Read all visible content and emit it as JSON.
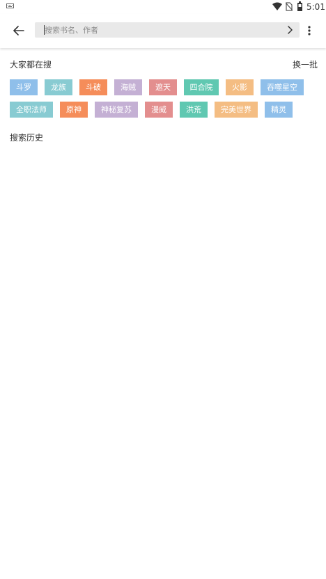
{
  "status_bar": {
    "time": "5:01",
    "icons": [
      "keyboard-icon",
      "wifi-icon",
      "no-sim-icon",
      "battery-icon"
    ]
  },
  "toolbar": {
    "back_icon": "arrow-left-icon",
    "search_placeholder": "搜索书名、作者",
    "search_value": "",
    "search_go_icon": "chevron-right-icon",
    "more_icon": "more-vert-icon"
  },
  "hot_searches": {
    "title": "大家都在搜",
    "refresh_label": "换一批",
    "tags": [
      {
        "label": "斗罗",
        "color": "#8fbfea"
      },
      {
        "label": "龙族",
        "color": "#88cbd2"
      },
      {
        "label": "斗破",
        "color": "#f58d5a"
      },
      {
        "label": "海贼",
        "color": "#c4b0d4"
      },
      {
        "label": "遮天",
        "color": "#e38e8e"
      },
      {
        "label": "四合院",
        "color": "#60c8b1"
      },
      {
        "label": "火影",
        "color": "#f4bd83"
      },
      {
        "label": "吞噬星空",
        "color": "#8fbfea"
      },
      {
        "label": "全职法师",
        "color": "#88cbd2"
      },
      {
        "label": "原神",
        "color": "#f58d5a"
      },
      {
        "label": "神秘复苏",
        "color": "#c4b0d4"
      },
      {
        "label": "漫威",
        "color": "#e38e8e"
      },
      {
        "label": "洪荒",
        "color": "#60c8b1"
      },
      {
        "label": "完美世界",
        "color": "#f4bd83"
      },
      {
        "label": "精灵",
        "color": "#8fbfea"
      }
    ]
  },
  "history": {
    "title": "搜索历史",
    "items": []
  }
}
